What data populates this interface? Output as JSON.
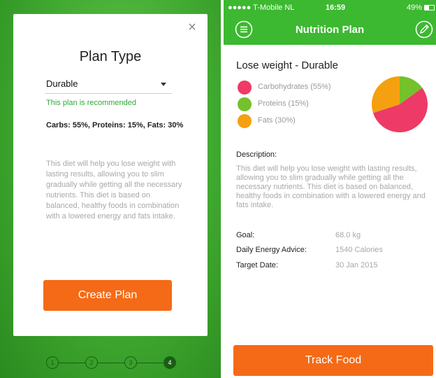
{
  "left": {
    "close_symbol": "×",
    "title": "Plan Type",
    "plan_select": {
      "value": "Durable"
    },
    "recommended": "This plan is recommended",
    "macros": "Carbs: 55%, Proteins: 15%, Fats: 30%",
    "description": "This diet will help you lose weight with lasting results, allowing you to slim gradually while getting all the necessary nutrients. This diet is based on balanced, healthy foods in combination with a lowered energy  and fats intake.",
    "create_button": "Create Plan",
    "steps": [
      "1",
      "2",
      "3",
      "4"
    ],
    "active_step": 4
  },
  "right": {
    "status": {
      "carrier": "●●●●● T-Mobile NL",
      "time": "16:59",
      "battery": "49%"
    },
    "nav_title": "Nutrition Plan",
    "plan_name": "Lose weight - Durable",
    "legend": [
      {
        "label": "Carbohydrates (55%)",
        "color": "#ee3a66"
      },
      {
        "label": "Proteins (15%)",
        "color": "#74c12a"
      },
      {
        "label": "Fats (30%)",
        "color": "#f5a00e"
      }
    ],
    "description_label": "Description:",
    "description": "This diet will help you lose weight with lasting results, allowing you to slim gradually while getting all the necessary nutrients. This diet is based on balanced, healthy foods in combination with a lowered energy  and fats intake.",
    "info": [
      {
        "label": "Goal:",
        "value": "68.0 kg"
      },
      {
        "label": "Daily Energy Advice:",
        "value": "1540 Calories"
      },
      {
        "label": "Target Date:",
        "value": "30 Jan 2015"
      }
    ],
    "track_button": "Track Food"
  },
  "colors": {
    "green": "#3cb930",
    "orange": "#f56a16"
  },
  "icons": {
    "menu": "menu-icon",
    "edit": "pencil-icon",
    "close": "close-icon",
    "dropdown": "caret-down-icon"
  },
  "chart_data": {
    "type": "pie",
    "categories": [
      "Carbohydrates",
      "Proteins",
      "Fats"
    ],
    "values": [
      55,
      15,
      30
    ],
    "colors": [
      "#ee3a66",
      "#74c12a",
      "#f5a00e"
    ]
  }
}
